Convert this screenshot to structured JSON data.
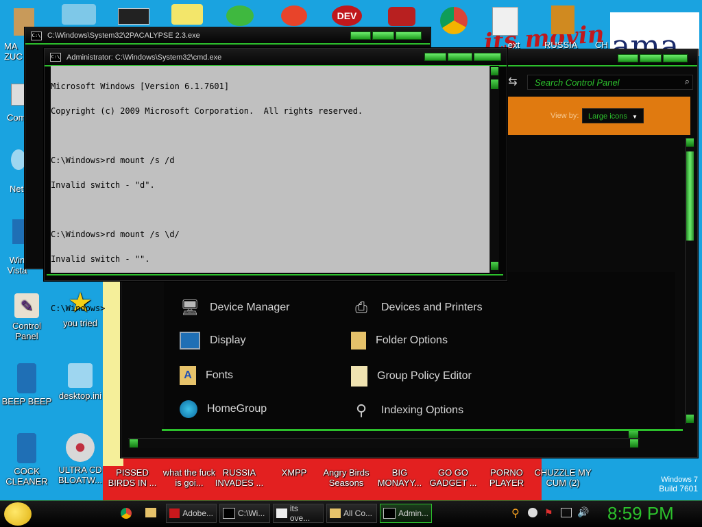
{
  "desktop": {
    "wallpaper_text": {
      "script": "its movin",
      "ama": "ama"
    },
    "watermark": {
      "line1": "Windows 7",
      "line2": "Build 7601"
    },
    "top_labels": [
      "MA ZUC",
      "Com",
      "Net",
      "Win Vista",
      "B"
    ],
    "top_row_labels": [
      "...ext",
      "RUSSIA",
      "CH"
    ],
    "icons_left": [
      {
        "label": "Control Panel"
      },
      {
        "label": "you tried"
      },
      {
        "label": "BEEP BEEP"
      },
      {
        "label": "desktop.ini"
      },
      {
        "label": "COCK CLEANER"
      },
      {
        "label": "ULTRA CD BLOATW..."
      }
    ],
    "icons_bottom": [
      {
        "label": "PISSED BIRDS IN ..."
      },
      {
        "label": "what the fuck is goi..."
      },
      {
        "label": "RUSSIA INVADES ..."
      },
      {
        "label": "XMPP"
      },
      {
        "label": "Angry Birds Seasons"
      },
      {
        "label": "BIG MONAYY..."
      },
      {
        "label": "GO GO GADGET ..."
      },
      {
        "label": "PORNO PLAYER"
      },
      {
        "label": "CHUZZLE MY CUM (2)"
      }
    ]
  },
  "back_window": {
    "title": "C:\\Windows\\System32\\2PACALYPSE 2.3.exe"
  },
  "cmd_window": {
    "title": "Administrator: C:\\Windows\\System32\\cmd.exe",
    "lines": [
      "Microsoft Windows [Version 6.1.7601]",
      "Copyright (c) 2009 Microsoft Corporation.  All rights reserved.",
      "",
      "C:\\Windows>rd mount /s /d",
      "Invalid switch - \"d\".",
      "",
      "C:\\Windows>rd mount /s \\d/",
      "Invalid switch - \"\".",
      "",
      "C:\\Windows>"
    ]
  },
  "control_panel": {
    "search_placeholder": "Search Control Panel",
    "view_by_label": "View by:",
    "view_by_value": "Large icons",
    "items": [
      {
        "label": "Device Manager",
        "icon": "device-manager-icon"
      },
      {
        "label": "Devices and Printers",
        "icon": "printer-icon"
      },
      {
        "label": "Display",
        "icon": "display-icon"
      },
      {
        "label": "Folder Options",
        "icon": "folder-options-icon"
      },
      {
        "label": "Fonts",
        "icon": "fonts-icon"
      },
      {
        "label": "Group Policy Editor",
        "icon": "group-policy-icon"
      },
      {
        "label": "HomeGroup",
        "icon": "homegroup-icon"
      },
      {
        "label": "Indexing Options",
        "icon": "indexing-icon"
      }
    ]
  },
  "taskbar": {
    "buttons": [
      {
        "label": "Adobe..."
      },
      {
        "label": "C:\\Wi..."
      },
      {
        "label": "its ove..."
      },
      {
        "label": "All Co..."
      },
      {
        "label": "Admin..."
      }
    ],
    "clock": "8:59 PM"
  },
  "colors": {
    "accent": "#2cc02c",
    "orange": "#e07a10",
    "console_bg": "#c0c0c0"
  }
}
